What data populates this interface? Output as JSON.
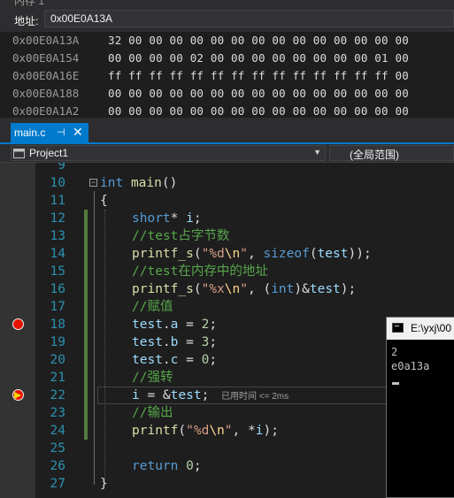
{
  "memory": {
    "title": "内存 1",
    "address_label": "地址:",
    "address_value": "0x00E0A13A",
    "rows": [
      {
        "address": "0x00E0A13A",
        "bytes": "32 00 00 00 00 00 00 00 00 00 00 00 00 00 00"
      },
      {
        "address": "0x00E0A154",
        "bytes": "00 00 00 00 02 00 00 00 00 00 00 00 00 01 00"
      },
      {
        "address": "0x00E0A16E",
        "bytes": "ff ff ff ff ff ff ff ff ff ff ff ff ff ff 00"
      },
      {
        "address": "0x00E0A188",
        "bytes": "00 00 00 00 00 00 00 00 00 00 00 00 00 00 00"
      },
      {
        "address": "0x00E0A1A2",
        "bytes": "00 00 00 00 00 00 00 00 00 00 00 00 00 00 00"
      }
    ]
  },
  "tab": {
    "label": "main.c",
    "pin": "⊣",
    "close": "✕"
  },
  "navbar": {
    "project": "Project1",
    "scope": "(全局范围)"
  },
  "editor": {
    "line_numbers": [
      "9",
      "10",
      "11",
      "12",
      "13",
      "14",
      "15",
      "16",
      "17",
      "18",
      "19",
      "20",
      "21",
      "22",
      "23",
      "24",
      "25",
      "26",
      "27"
    ],
    "perf_tip": "已用时间 <= 2ms",
    "code": {
      "l10_kw": "int",
      "l10_fn": "main",
      "l10_rest": "()",
      "l11": "{",
      "l12_kw": "short",
      "l12_star": "* ",
      "l12_var": "i",
      "l12_end": ";",
      "l13": "//test占字节数",
      "l14_fn": "printf_s",
      "l14_p": "(",
      "l14_s1": "\"%d",
      "l14_esc": "\\n",
      "l14_s2": "\"",
      "l14_c": ", ",
      "l14_kw": "sizeof",
      "l14_p2": "(",
      "l14_var": "test",
      "l14_end": "));",
      "l15": "//test在内存中的地址",
      "l16_fn": "printf_s",
      "l16_p": "(",
      "l16_s1": "\"%x",
      "l16_esc": "\\n",
      "l16_s2": "\"",
      "l16_c": ", (",
      "l16_kw": "int",
      "l16_amp": ")&",
      "l16_var": "test",
      "l16_end": ");",
      "l17": "//赋值",
      "l18_var": "test",
      "l18_dot": ".",
      "l18_m": "a",
      "l18_eq": " = ",
      "l18_num": "2",
      "l18_end": ";",
      "l19_var": "test",
      "l19_dot": ".",
      "l19_m": "b",
      "l19_eq": " = ",
      "l19_num": "3",
      "l19_end": ";",
      "l20_var": "test",
      "l20_dot": ".",
      "l20_m": "c",
      "l20_eq": " = ",
      "l20_num": "0",
      "l20_end": ";",
      "l21": "//强转",
      "l22_var": "i",
      "l22_eq": " = &",
      "l22_var2": "test",
      "l22_end": ";",
      "l23": "//输出",
      "l24_fn": "printf",
      "l24_p": "(",
      "l24_s1": "\"%d",
      "l24_esc": "\\n",
      "l24_s2": "\"",
      "l24_c": ", *",
      "l24_var": "i",
      "l24_end": ");",
      "l26_kw": "return",
      "l26_sp": " ",
      "l26_num": "0",
      "l26_end": ";",
      "l27": "}"
    }
  },
  "console": {
    "title": "E:\\yxj\\00",
    "lines": [
      "2",
      "e0a13a"
    ]
  }
}
